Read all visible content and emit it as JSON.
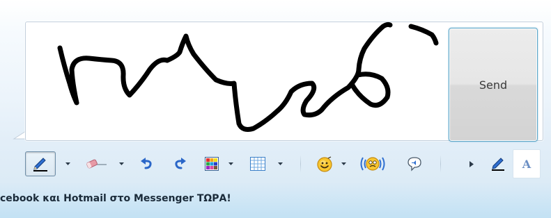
{
  "ink_area": {
    "mode": "handwriting",
    "ink_color": "#000000"
  },
  "send_button": {
    "label": "Send"
  },
  "toolbar": {
    "buttons": [
      {
        "id": "pen",
        "icon": "pen-icon",
        "state": "pressed"
      },
      {
        "id": "pen-options",
        "icon": "chevron-down-icon"
      },
      {
        "id": "eraser",
        "icon": "eraser-icon"
      },
      {
        "id": "eraser-options",
        "icon": "chevron-down-icon"
      },
      {
        "id": "undo",
        "icon": "undo-icon"
      },
      {
        "id": "redo",
        "icon": "redo-icon"
      },
      {
        "id": "color-palette",
        "icon": "color-grid-icon"
      },
      {
        "id": "background-grid",
        "icon": "grid-icon"
      },
      {
        "id": "emoticons",
        "icon": "smiley-icon"
      },
      {
        "id": "nudge",
        "icon": "nudge-icon"
      },
      {
        "id": "voice-clip",
        "icon": "speech-bubble-icon"
      },
      {
        "id": "more",
        "icon": "triangle-right-icon"
      },
      {
        "id": "handwriting-mode",
        "icon": "pen-icon"
      },
      {
        "id": "type-mode",
        "icon": "letter-a-icon"
      }
    ],
    "type_mode_label": "A"
  },
  "promo_bar": {
    "text": "cebook και Hotmail στο Messenger ΤΩΡΑ!"
  },
  "colors": {
    "accent_blue": "#2f6fd0",
    "send_border": "#5aa5c7",
    "eraser_pink": "#e79aa6"
  }
}
